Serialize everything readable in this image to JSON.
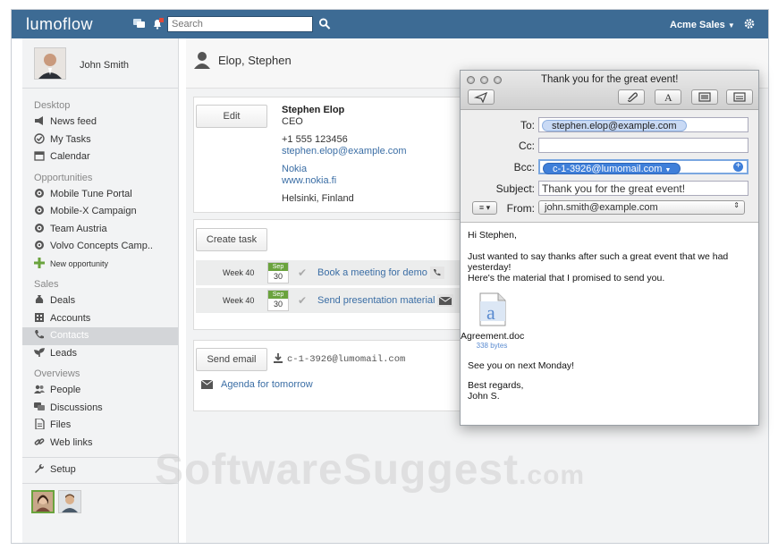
{
  "app": {
    "logo": "lumoflow",
    "search_placeholder": "Search",
    "org": "Acme Sales"
  },
  "user": {
    "name": "John Smith"
  },
  "sidebar": {
    "desktop": {
      "title": "Desktop",
      "items": [
        "News feed",
        "My Tasks",
        "Calendar"
      ]
    },
    "opportunities": {
      "title": "Opportunities",
      "items": [
        "Mobile Tune Portal",
        "Mobile-X Campaign",
        "Team Austria",
        "Volvo Concepts Camp.."
      ],
      "new": "New opportunity"
    },
    "sales": {
      "title": "Sales",
      "items": [
        "Deals",
        "Accounts",
        "Contacts",
        "Leads"
      ]
    },
    "overviews": {
      "title": "Overviews",
      "items": [
        "People",
        "Discussions",
        "Files",
        "Web links"
      ]
    },
    "setup": "Setup"
  },
  "contact": {
    "header_name": "Elop, Stephen",
    "edit_label": "Edit",
    "name": "Stephen Elop",
    "title": "CEO",
    "phone": "+1 555 123456",
    "email": "stephen.elop@example.com",
    "company": "Nokia",
    "website": "www.nokia.fi",
    "city": "Helsinki, Finland"
  },
  "tasks": {
    "create_label": "Create task",
    "rows": [
      {
        "week": "Week 40",
        "month": "Sep",
        "day": "30",
        "text": "Book a meeting for demo"
      },
      {
        "week": "Week 40",
        "month": "Sep",
        "day": "30",
        "text": "Send presentation material"
      }
    ]
  },
  "emails": {
    "send_label": "Send email",
    "bcc_address": "c-1-3926@lumomail.com",
    "item": "Agenda for tomorrow"
  },
  "mail_window": {
    "title": "Thank you for the great event!",
    "to_label": "To:",
    "to": "stephen.elop@example.com",
    "cc_label": "Cc:",
    "bcc_label": "Bcc:",
    "bcc": "c-1-3926@lumomail.com",
    "subject_label": "Subject:",
    "subject": "Thank you for the great event!",
    "from_label": "From:",
    "from": "john.smith@example.com",
    "body": {
      "greeting": "Hi Stephen,",
      "line1": "Just wanted to say thanks after such a great event that we had yesterday!",
      "line2": "Here's the material that I promised to send you.",
      "attachment_name": "Agreement.doc",
      "attachment_size": "338 bytes",
      "line3": "See you on next Monday!",
      "closing": "Best regards,",
      "signature": "John S."
    }
  },
  "watermark": {
    "main": "SoftwareSuggest",
    "suffix": ".com"
  },
  "colors": {
    "topbar": "#3d6b94",
    "link": "#3b6ea5",
    "task_green": "#6aa33d",
    "pill_selected": "#3f7fd9"
  }
}
